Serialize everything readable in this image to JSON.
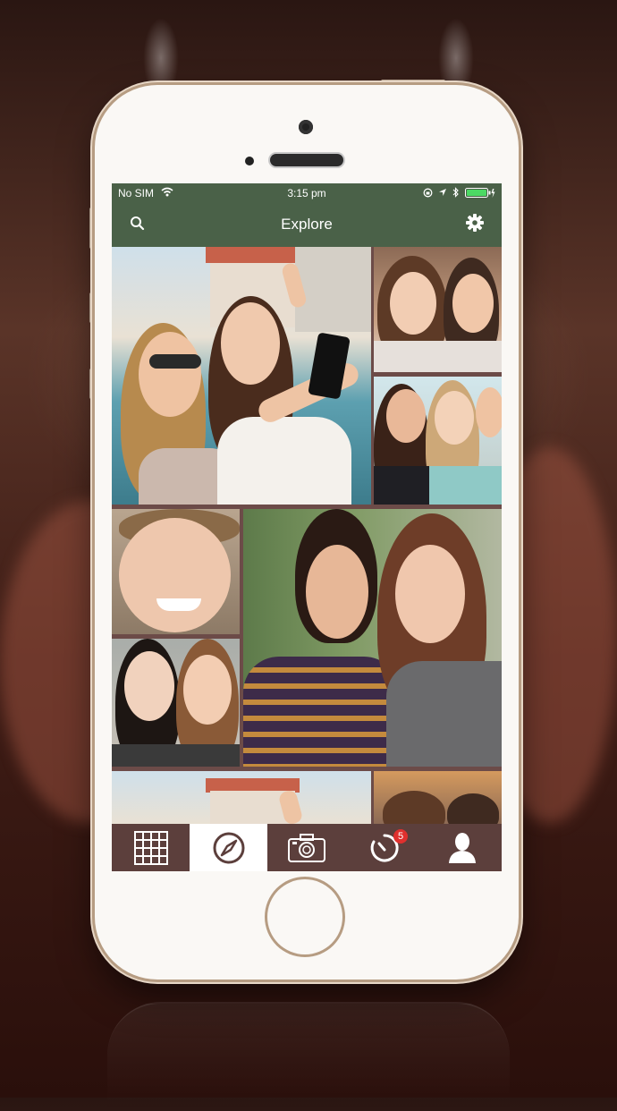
{
  "status_bar": {
    "carrier": "No SIM",
    "time": "3:15 pm"
  },
  "nav": {
    "title": "Explore"
  },
  "tabbar": {
    "tabs": [
      {
        "icon": "grid-icon",
        "active": false
      },
      {
        "icon": "compass-icon",
        "active": true
      },
      {
        "icon": "camera-icon",
        "active": false
      },
      {
        "icon": "timer-icon",
        "active": false
      },
      {
        "icon": "profile-icon",
        "active": false
      }
    ],
    "notification_count": "5"
  },
  "colors": {
    "header": "#4a6148",
    "tabbar": "#5c3f3c",
    "badge": "#e0302e"
  }
}
